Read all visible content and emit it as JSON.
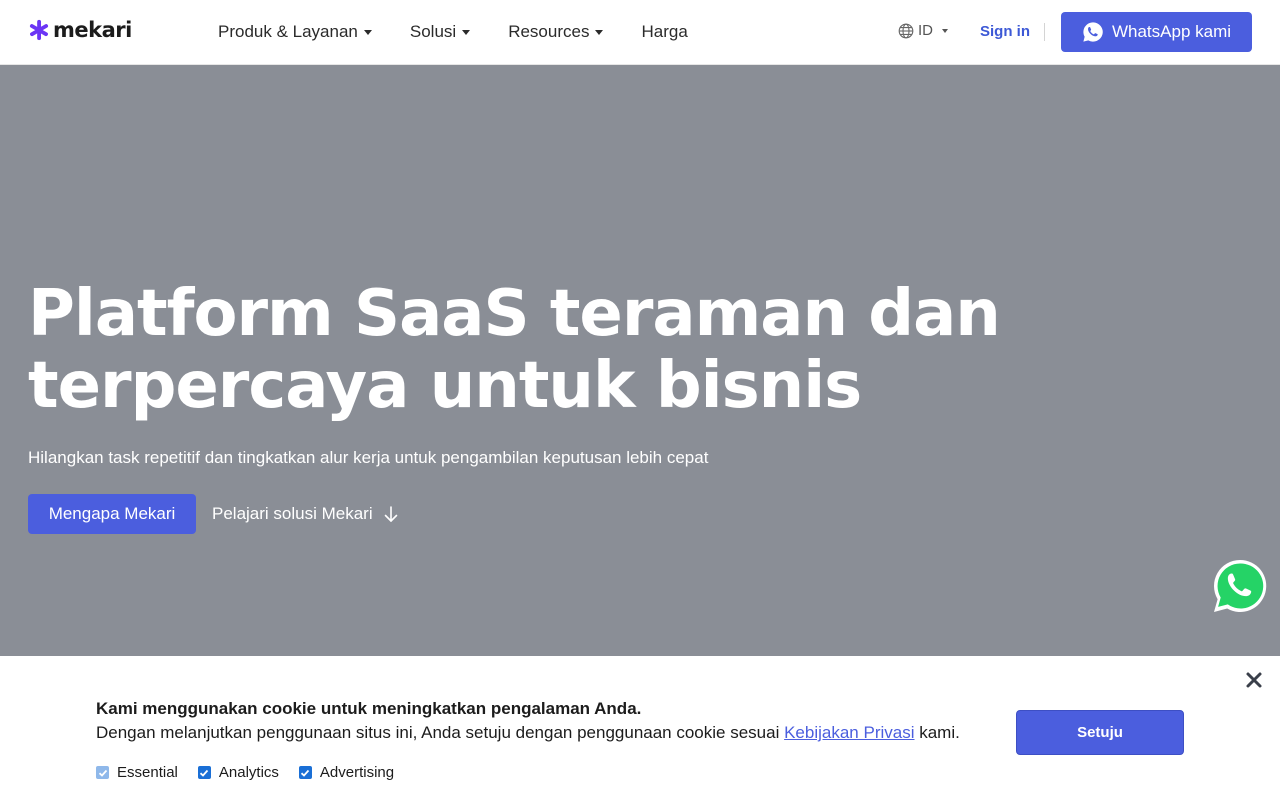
{
  "header": {
    "logo_text": "mekari",
    "nav": [
      {
        "label": "Produk & Layanan",
        "has_dropdown": true
      },
      {
        "label": "Solusi",
        "has_dropdown": true
      },
      {
        "label": "Resources",
        "has_dropdown": true
      },
      {
        "label": "Harga",
        "has_dropdown": false
      }
    ],
    "language": "ID",
    "signin_label": "Sign in",
    "whatsapp_label": "WhatsApp kami",
    "icons": {
      "logo": "mekari-asterisk-icon",
      "language": "globe-icon",
      "whatsapp": "whatsapp-icon"
    }
  },
  "hero": {
    "title_line1": "Platform SaaS teraman dan",
    "title_line2": "terpercaya untuk bisnis",
    "subtitle": "Hilangkan task repetitif dan tingkatkan alur kerja untuk pengambilan keputusan lebih cepat",
    "primary_button": "Mengapa Mekari",
    "secondary_link": "Pelajari solusi Mekari"
  },
  "cookie_banner": {
    "title": "Kami menggunakan cookie untuk meningkatkan pengalaman Anda.",
    "text_before": "Dengan melanjutkan penggunaan situs ini, Anda setuju dengan penggunaan cookie sesuai ",
    "link": "Kebijakan Privasi",
    "text_after": " kami.",
    "options": [
      {
        "label": "Essential",
        "checked": true,
        "disabled": true
      },
      {
        "label": "Analytics",
        "checked": true,
        "disabled": false
      },
      {
        "label": "Advertising",
        "checked": true,
        "disabled": false
      }
    ],
    "accept_label": "Setuju"
  },
  "colors": {
    "brand": "#4b5ede",
    "logo_purple": "#6b35f5",
    "hero_overlay": "#8a8e96",
    "link_blue": "#3d59d6",
    "whatsapp_green": "#25d366"
  }
}
